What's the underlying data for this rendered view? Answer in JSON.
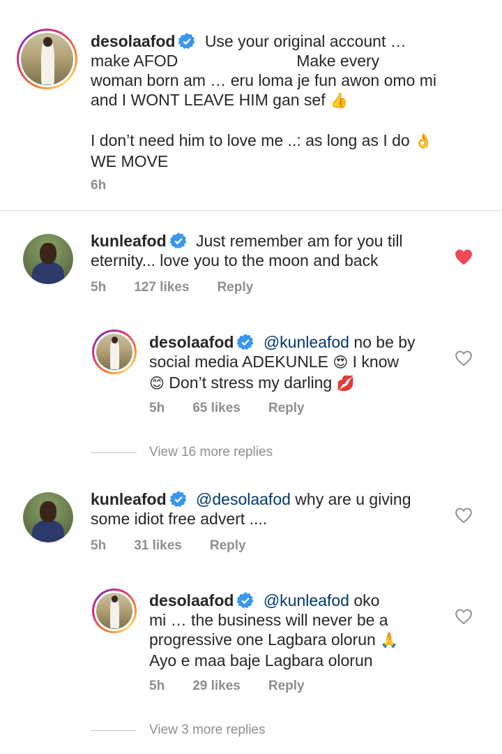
{
  "comments": [
    {
      "username": "desolaafod",
      "text_line1": "Use your original account …",
      "text_line2a": "make AFOD",
      "text_line2b": "Make every",
      "text_line3": "woman born am … eru loma je fun awon omo mi",
      "text_line4": "and I WONT LEAVE HIM gan sef",
      "text_line4_emoji": "👍",
      "text_line5": "I don’t need him to love me ..: as long as I do",
      "text_line5_emoji": "👌",
      "text_line6": "WE MOVE",
      "time": "6h"
    },
    {
      "username": "kunleafod",
      "text_line1": "Just remember am for you till",
      "text_line2": "eternity... love you to the moon and back",
      "time": "5h",
      "likes": "127 likes",
      "reply": "Reply",
      "liked": true
    },
    {
      "username": "desolaafod",
      "mention": "@kunleafod",
      "text_line1": "no be by",
      "text_line2": "social media ADEKUNLE",
      "text_line2_emoji": "😍",
      "text_line2b": "I know",
      "text_line3_emoji": "😊",
      "text_line3": "Don’t stress my darling",
      "text_line3_emoji2": "💋",
      "time": "5h",
      "likes": "65 likes",
      "reply": "Reply",
      "liked": false
    },
    {
      "username": "kunleafod",
      "mention": "@desolaafod",
      "text_line1": "why are u giving",
      "text_line2": "some idiot free advert ....",
      "time": "5h",
      "likes": "31 likes",
      "reply": "Reply",
      "liked": false
    },
    {
      "username": "desolaafod",
      "mention": "@kunleafod",
      "text_line1": "oko",
      "text_line2": "mi … the business will never be a",
      "text_line3": "progressive one Lagbara olorun",
      "text_line3_emoji": "🙏",
      "text_line4": "Ayo e maa baje Lagbara olorun",
      "time": "5h",
      "likes": "29 likes",
      "reply": "Reply",
      "liked": false
    }
  ],
  "view_more_1": "View 16 more replies",
  "view_more_2": "View 3 more replies",
  "colors": {
    "text": "#262626",
    "meta": "#8e8e8e",
    "mention": "#00376b",
    "verified": "#3897f0",
    "heart_liked": "#ed4956"
  },
  "icons": {
    "verified": "verified-badge-icon",
    "heart": "heart-icon"
  }
}
